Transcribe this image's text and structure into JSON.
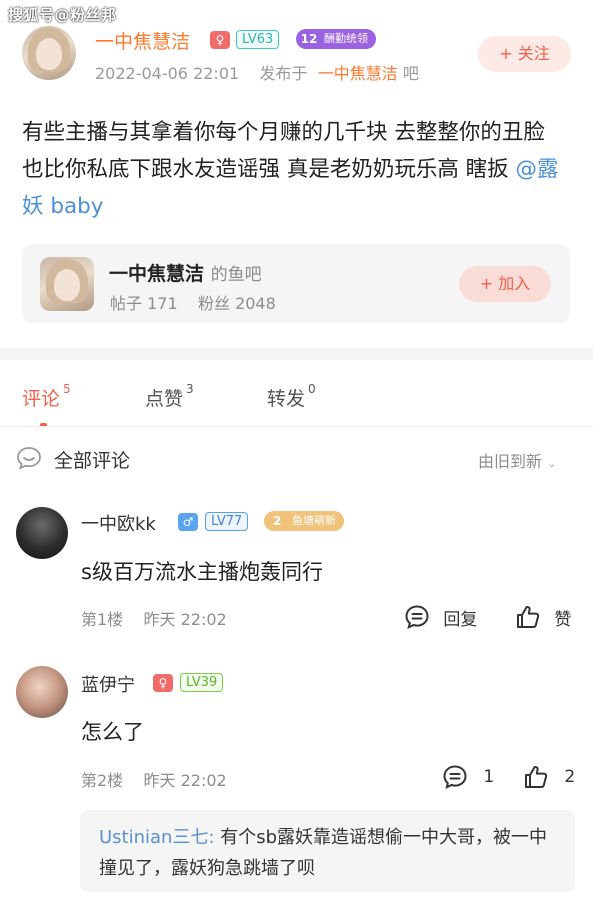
{
  "watermark": "搜狐号@粉丝邦",
  "post": {
    "author": "一中焦慧洁",
    "gender_symbol": "♀",
    "level": "LV63",
    "fan_badge_num": "12",
    "fan_badge_text": "酬勤统领",
    "timestamp": "2022-04-06 22:01",
    "posted_in_prefix": "发布于",
    "bar_name": "一中焦慧洁",
    "bar_suffix": "吧",
    "follow_label": "+ 关注",
    "text": "有些主播与其拿着你每个月赚的几千块 去整整你的丑脸 也比你私底下跟水友造谣强 真是老奶奶玩乐高 瞎扳",
    "mention": "@露妖 baby"
  },
  "bar_card": {
    "name": "一中焦慧洁",
    "suffix": "的鱼吧",
    "posts_label": "帖子 171",
    "fans_label": "粉丝 2048",
    "join_label": "+ 加入"
  },
  "tabs": [
    {
      "label": "评论",
      "count": "5"
    },
    {
      "label": "点赞",
      "count": "3"
    },
    {
      "label": "转发",
      "count": "0"
    }
  ],
  "comments_header": {
    "title": "全部评论",
    "sort": "由旧到新"
  },
  "comments": [
    {
      "name": "一中欧kk",
      "gender_symbol": "♂",
      "level": "LV77",
      "fan_badge_num": "2",
      "fan_badge_text": "鱼塘萌新",
      "text": "s级百万流水主播炮轰同行",
      "floor": "第1楼",
      "time": "昨天 22:02",
      "reply_label": "回复",
      "like_label": "赞"
    },
    {
      "name": "蓝伊宁",
      "gender_symbol": "♀",
      "level": "LV39",
      "text": "怎么了",
      "floor": "第2楼",
      "time": "昨天 22:02",
      "reply_count": "1",
      "like_count": "2",
      "sub_reply": {
        "name": "Ustinian三七:",
        "text": " 有个sb露妖靠造谣想偷一中大哥，被一中撞见了，露妖狗急跳墙了呗"
      }
    }
  ],
  "colors": {
    "accent": "#f25f4b",
    "author_orange": "#ff7a2e",
    "mention_blue": "#4a90d9"
  }
}
